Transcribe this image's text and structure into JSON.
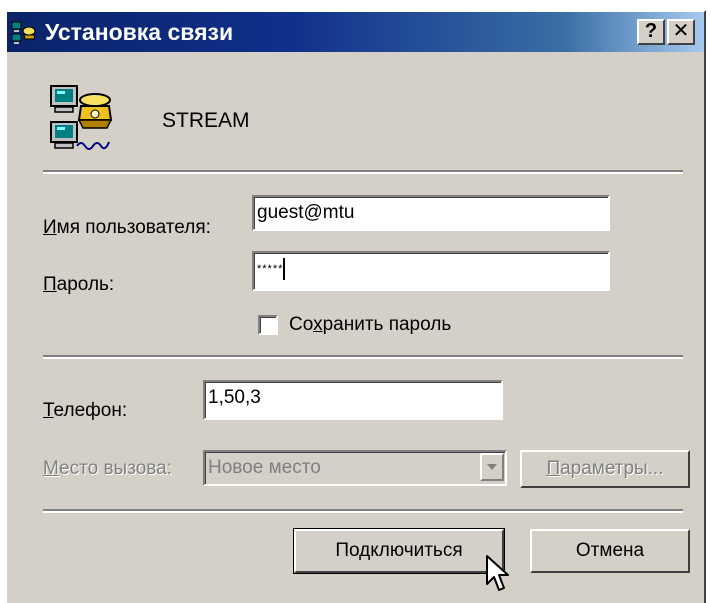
{
  "window": {
    "title": "Установка связи",
    "help_button": "?",
    "close_button": "✕"
  },
  "connection": {
    "name": "STREAM"
  },
  "form": {
    "username_label": "Имя пользователя:",
    "username_value": "guest@mtu",
    "password_label": "Пароль:",
    "password_value": "*****",
    "save_password_label": "Сохранить пароль",
    "save_password_checked": false,
    "phone_label": "Телефон:",
    "phone_value": "1,50,3",
    "dial_from_label": "Место вызова:",
    "dial_from_value": "Новое место",
    "dial_properties_button": "Параметры..."
  },
  "buttons": {
    "connect": "Подключиться",
    "cancel": "Отмена"
  }
}
